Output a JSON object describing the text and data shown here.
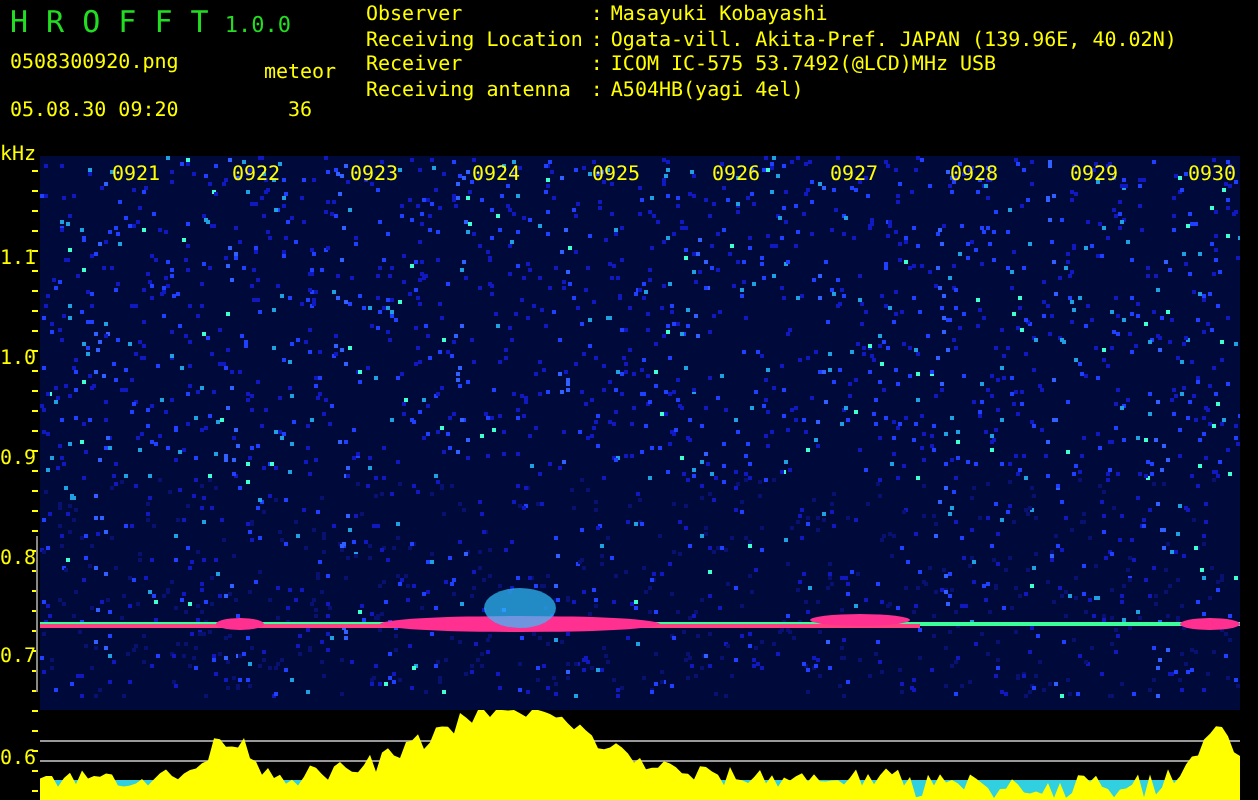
{
  "app": {
    "title": "H R O F F T",
    "version": "1.0.0"
  },
  "file": {
    "name": "0508300920.png",
    "datetime": "05.08.30 09:20"
  },
  "meteor": {
    "label": "meteor",
    "count": "36"
  },
  "info": [
    {
      "label": "Observer",
      "sep": ":",
      "value": "Masayuki Kobayashi"
    },
    {
      "label": "Receiving Location",
      "sep": ":",
      "value": "Ogata-vill. Akita-Pref. JAPAN (139.96E, 40.02N)"
    },
    {
      "label": "Receiver",
      "sep": ":",
      "value": "ICOM IC-575 53.7492(@LCD)MHz USB"
    },
    {
      "label": "Receiving antenna",
      "sep": ":",
      "value": "A504HB(yagi 4el)"
    }
  ],
  "plot": {
    "unit": "kHz",
    "time_labels": [
      "0921",
      "0922",
      "0923",
      "0924",
      "0925",
      "0926",
      "0927",
      "0928",
      "0929",
      "0930"
    ],
    "freq_labels": [
      "1.1",
      "1.0",
      "0.9",
      "0.8",
      "0.7",
      "0.6"
    ]
  }
}
